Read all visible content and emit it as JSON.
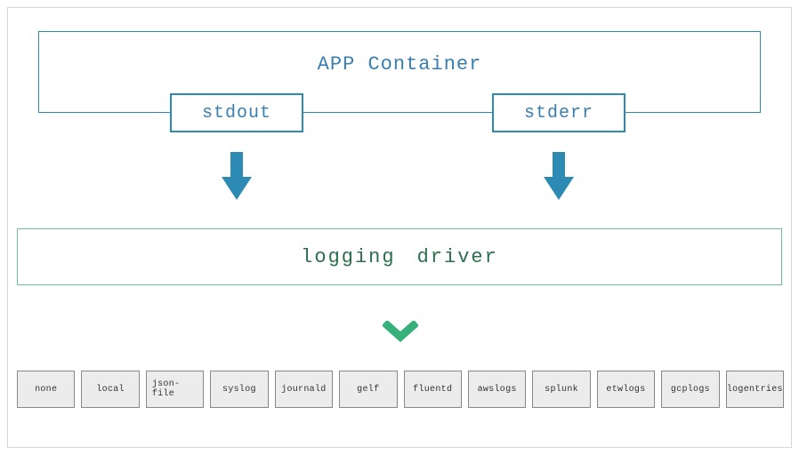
{
  "app_container": {
    "label": "APP Container",
    "stdout": "stdout",
    "stderr": "stderr"
  },
  "logging_driver": {
    "label_left": "logging",
    "label_right": "driver"
  },
  "drivers": [
    "none",
    "local",
    "json-file",
    "syslog",
    "journald",
    "gelf",
    "fluentd",
    "awslogs",
    "splunk",
    "etwlogs",
    "gcplogs",
    "logentries"
  ],
  "colors": {
    "blue": "#2d8bb3",
    "green_border": "#6bc49a",
    "green_text": "#2a6f4e",
    "chevron": "#37b07a",
    "driver_bg": "#ececec"
  }
}
